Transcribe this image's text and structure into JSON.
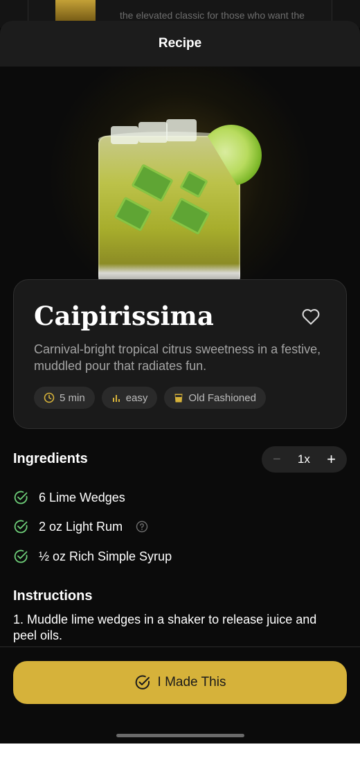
{
  "background_card": {
    "text": "the elevated classic for those who want the"
  },
  "header": {
    "title": "Recipe"
  },
  "drink": {
    "name": "Caipirissima",
    "description": "Carnival-bright tropical citrus sweetness in a festive, muddled pour that radiates fun.",
    "chips": [
      {
        "icon": "clock-icon",
        "label": "5 min"
      },
      {
        "icon": "bar-chart-icon",
        "label": "easy"
      },
      {
        "icon": "old-fashioned-glass-icon",
        "label": "Old Fashioned"
      }
    ]
  },
  "ingredients": {
    "title": "Ingredients",
    "servings": {
      "value": "1x",
      "minus": "−",
      "plus": "+"
    },
    "items": [
      {
        "label": "6 Lime Wedges",
        "checked": true
      },
      {
        "label": "2 oz Light Rum",
        "checked": true,
        "has_help": true
      },
      {
        "label": "½ oz Rich Simple Syrup",
        "checked": true
      }
    ]
  },
  "instructions": {
    "title": "Instructions",
    "steps": [
      "1. Muddle lime wedges in a shaker to release juice and peel oils."
    ]
  },
  "footer": {
    "button_label": "I Made This"
  },
  "colors": {
    "accent": "#d6b23a",
    "check": "#6fd07a",
    "background": "#0b0b0b",
    "card": "#1a1a1a"
  }
}
